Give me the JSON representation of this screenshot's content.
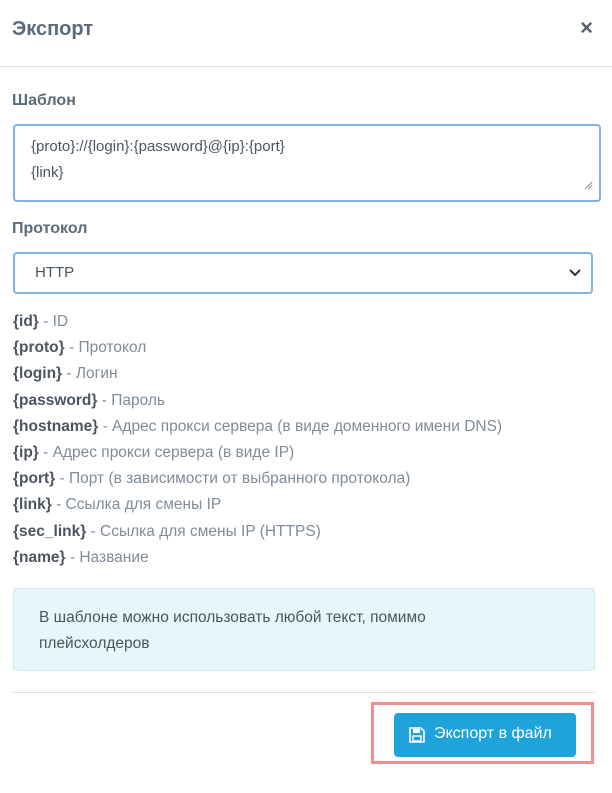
{
  "dialog": {
    "title": "Экспорт",
    "close_glyph": "×"
  },
  "template_section": {
    "label": "Шаблон",
    "value": "{proto}://{login}:{password}@{ip}:{port}\n{link}"
  },
  "protocol_section": {
    "label": "Протокол",
    "selected": "HTTP"
  },
  "placeholders": [
    {
      "key": "{id}",
      "desc": " - ID"
    },
    {
      "key": "{proto}",
      "desc": " - Протокол"
    },
    {
      "key": "{login}",
      "desc": " - Логин"
    },
    {
      "key": "{password}",
      "desc": " - Пароль"
    },
    {
      "key": "{hostname}",
      "desc": " - Адрес прокси сервера (в виде доменного имени DNS)"
    },
    {
      "key": "{ip}",
      "desc": " - Адрес прокси сервера (в виде IP)"
    },
    {
      "key": "{port}",
      "desc": " - Порт (в зависимости от выбранного протокола)"
    },
    {
      "key": "{link}",
      "desc": " - Ссылка для смены IP"
    },
    {
      "key": "{sec_link}",
      "desc": " - Ссылка для смены IP (HTTPS)"
    },
    {
      "key": "{name}",
      "desc": " - Название"
    }
  ],
  "info": {
    "text": "В шаблоне можно использовать любой текст, помимо плейсхолдеров"
  },
  "footer": {
    "export_label": "Экспорт в файл",
    "export_icon": "save-icon"
  },
  "colors": {
    "accent": "#1fa3da",
    "info_bg": "#e6f6fa",
    "highlight": "#ef8f8f"
  }
}
